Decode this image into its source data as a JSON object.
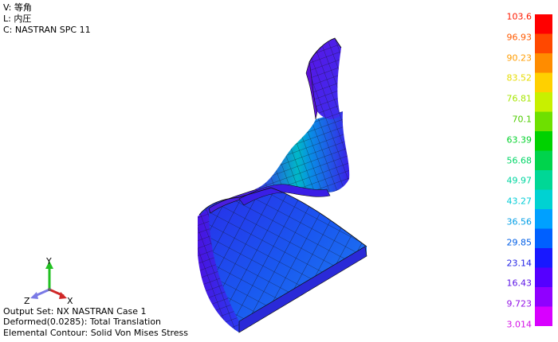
{
  "view_info": {
    "view": "V: 等角",
    "layer": "L: 内圧",
    "constraint": "C: NASTRAN SPC 11"
  },
  "output_info": {
    "output_set": "Output Set: NX NASTRAN Case 1",
    "deformed": "Deformed(0.0285): Total Translation",
    "contour": "Elemental Contour: Solid Von Mises Stress"
  },
  "axes": {
    "y": "Y",
    "z": "Z",
    "x": "X"
  },
  "legend": {
    "labels": [
      {
        "text": "103.6",
        "color": "#ff1a00"
      },
      {
        "text": "96.93",
        "color": "#ff5a00"
      },
      {
        "text": "90.23",
        "color": "#ff9c00"
      },
      {
        "text": "83.52",
        "color": "#e6dc00"
      },
      {
        "text": "76.81",
        "color": "#a6e600"
      },
      {
        "text": "70.1",
        "color": "#4ecc00"
      },
      {
        "text": "63.39",
        "color": "#00d22a"
      },
      {
        "text": "56.68",
        "color": "#00d666"
      },
      {
        "text": "49.97",
        "color": "#00d6a0"
      },
      {
        "text": "43.27",
        "color": "#00ccd6"
      },
      {
        "text": "36.56",
        "color": "#009ee6"
      },
      {
        "text": "29.85",
        "color": "#005ee6"
      },
      {
        "text": "23.14",
        "color": "#1f1fe6"
      },
      {
        "text": "16.43",
        "color": "#5a12e6"
      },
      {
        "text": "9.723",
        "color": "#9212e6"
      },
      {
        "text": "3.014",
        "color": "#d412e6"
      }
    ],
    "band_colors": [
      "#ff0000",
      "#ff4800",
      "#ff8c00",
      "#ffd000",
      "#c8f000",
      "#6ee000",
      "#00d200",
      "#00d34c",
      "#00d796",
      "#00d2d2",
      "#00a0ff",
      "#0060ff",
      "#1818ff",
      "#5500ff",
      "#9000ff",
      "#d800ff"
    ]
  }
}
